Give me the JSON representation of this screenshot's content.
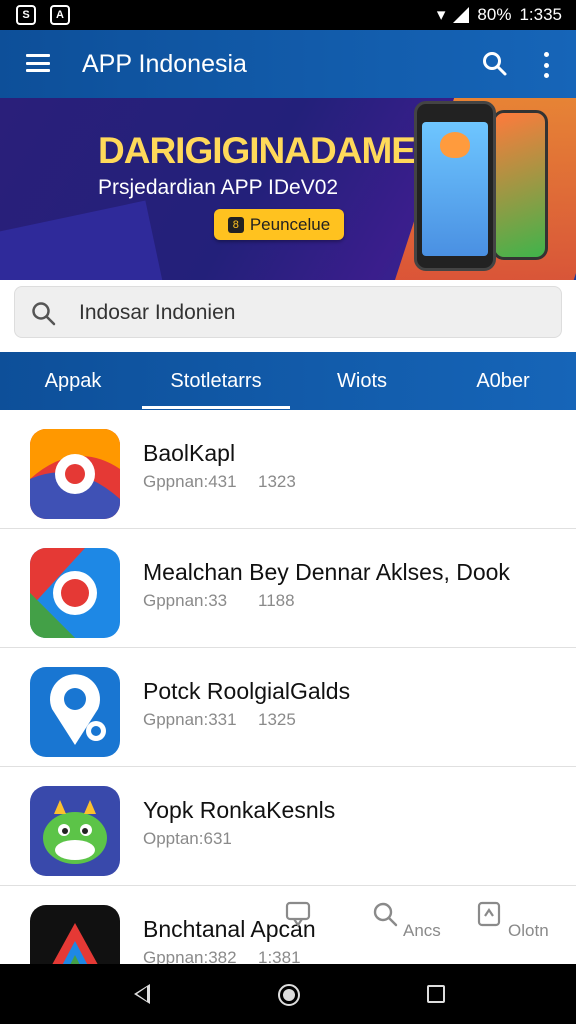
{
  "status_bar": {
    "percent": "80%",
    "time": "1:335",
    "icon_left_1": "S",
    "icon_left_2": "A"
  },
  "app_bar": {
    "title": "APP Indonesia"
  },
  "banner": {
    "title": "DARIGIGINADAMESIA",
    "subtitle": "Prsjedardian APP IDeV02",
    "button_label": "Peuncelue",
    "button_icon": "8"
  },
  "search": {
    "value": "Indosar Indonien"
  },
  "tabs": [
    {
      "label": "Appak"
    },
    {
      "label": "Stotletarrs"
    },
    {
      "label": "Wiots"
    },
    {
      "label": "A0ber"
    }
  ],
  "apps": [
    {
      "name": "BaolKapl",
      "meta": "Gppnan:431",
      "num": "1323"
    },
    {
      "name": "Mealchan Bey Dennar Aklses, Dook",
      "meta": "Gppnan:33",
      "num": "1188"
    },
    {
      "name": "Potck RoolgialGalds",
      "meta": "Gppnan:331",
      "num": "1325"
    },
    {
      "name": "Yopk RonkaKesnls",
      "meta": "Opptan:631",
      "num": ""
    },
    {
      "name": "Bnchtanal Apcan",
      "meta": "Gppnan:382",
      "num": "1:381"
    }
  ],
  "floating_actions": [
    {
      "label": "Ancs",
      "icon": "search-icon"
    },
    {
      "label": "Olotn",
      "icon": "share-icon"
    }
  ],
  "colors": {
    "primary": "#1565b8",
    "accent": "#ffc21f",
    "banner_title": "#ffd95a"
  }
}
